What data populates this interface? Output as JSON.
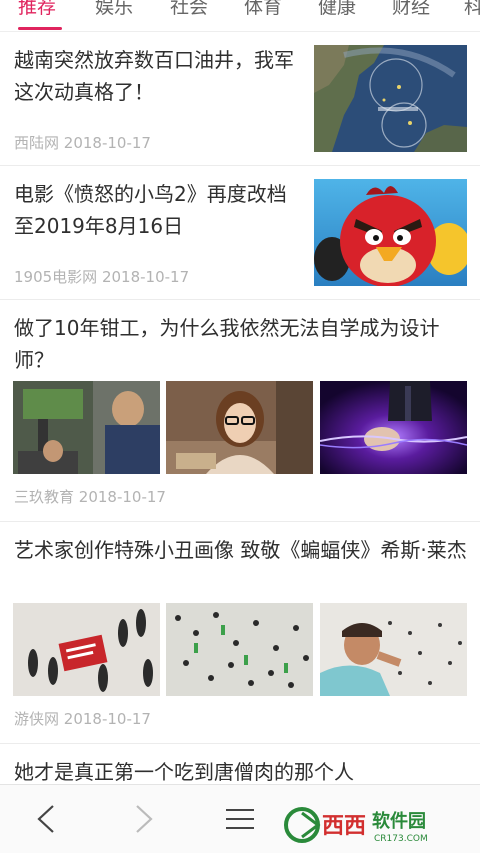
{
  "tabs": [
    {
      "label": "推荐",
      "active": true
    },
    {
      "label": "娱乐",
      "active": false
    },
    {
      "label": "社会",
      "active": false
    },
    {
      "label": "体育",
      "active": false
    },
    {
      "label": "健康",
      "active": false
    },
    {
      "label": "财经",
      "active": false
    },
    {
      "label": "科",
      "active": false
    }
  ],
  "articles": [
    {
      "title": "越南突然放弃数百口油井，我军这次动真格了！",
      "source": "西陆网",
      "date": "2018-10-17"
    },
    {
      "title": "电影《愤怒的小鸟2》再度改档至2019年8月16日",
      "source": "1905电影网",
      "date": "2018-10-17"
    },
    {
      "title": "做了10年钳工，为什么我依然无法自学成为设计师？",
      "source": "三玖教育",
      "date": "2018-10-17"
    },
    {
      "title": "艺术家创作特殊小丑画像 致敬《蝙蝠侠》希斯·莱杰",
      "source": "游侠网",
      "date": "2018-10-17"
    },
    {
      "title": "她才是真正第一个吃到唐僧肉的那个人"
    }
  ],
  "bottom_nav": {
    "back_icon": "chevron-left-icon",
    "forward_icon": "chevron-right-icon",
    "menu_icon": "hamburger-menu-icon"
  },
  "watermark": {
    "brand": "西西",
    "name": "软件园",
    "url": "CR173.COM"
  },
  "colors": {
    "accent": "#e0245e",
    "text": "#2f2f2f",
    "meta": "#b3b3b3"
  }
}
